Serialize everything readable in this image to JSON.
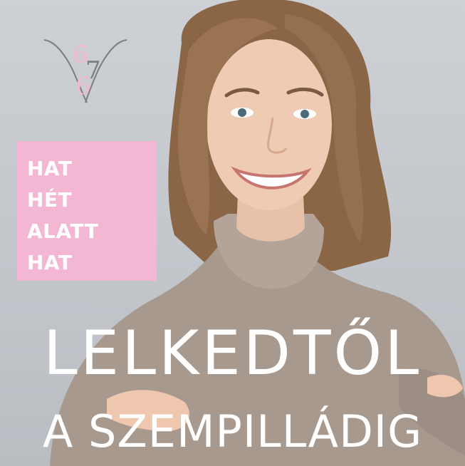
{
  "logo": {
    "digit_top": "6",
    "digit_middle": "7",
    "digit_bottom": "6"
  },
  "tagline": {
    "lines": [
      "HAT",
      "HÉT",
      "ALATT",
      "HAT"
    ]
  },
  "headline": {
    "line1": "LELKEDTŐL",
    "line2": "A SZEMPILLÁDIG"
  },
  "colors": {
    "accent_pink": "#f3b7d4",
    "logo_gray": "#7b7f84",
    "text_white": "#ffffff",
    "background_gray": "#c9cdd2"
  }
}
